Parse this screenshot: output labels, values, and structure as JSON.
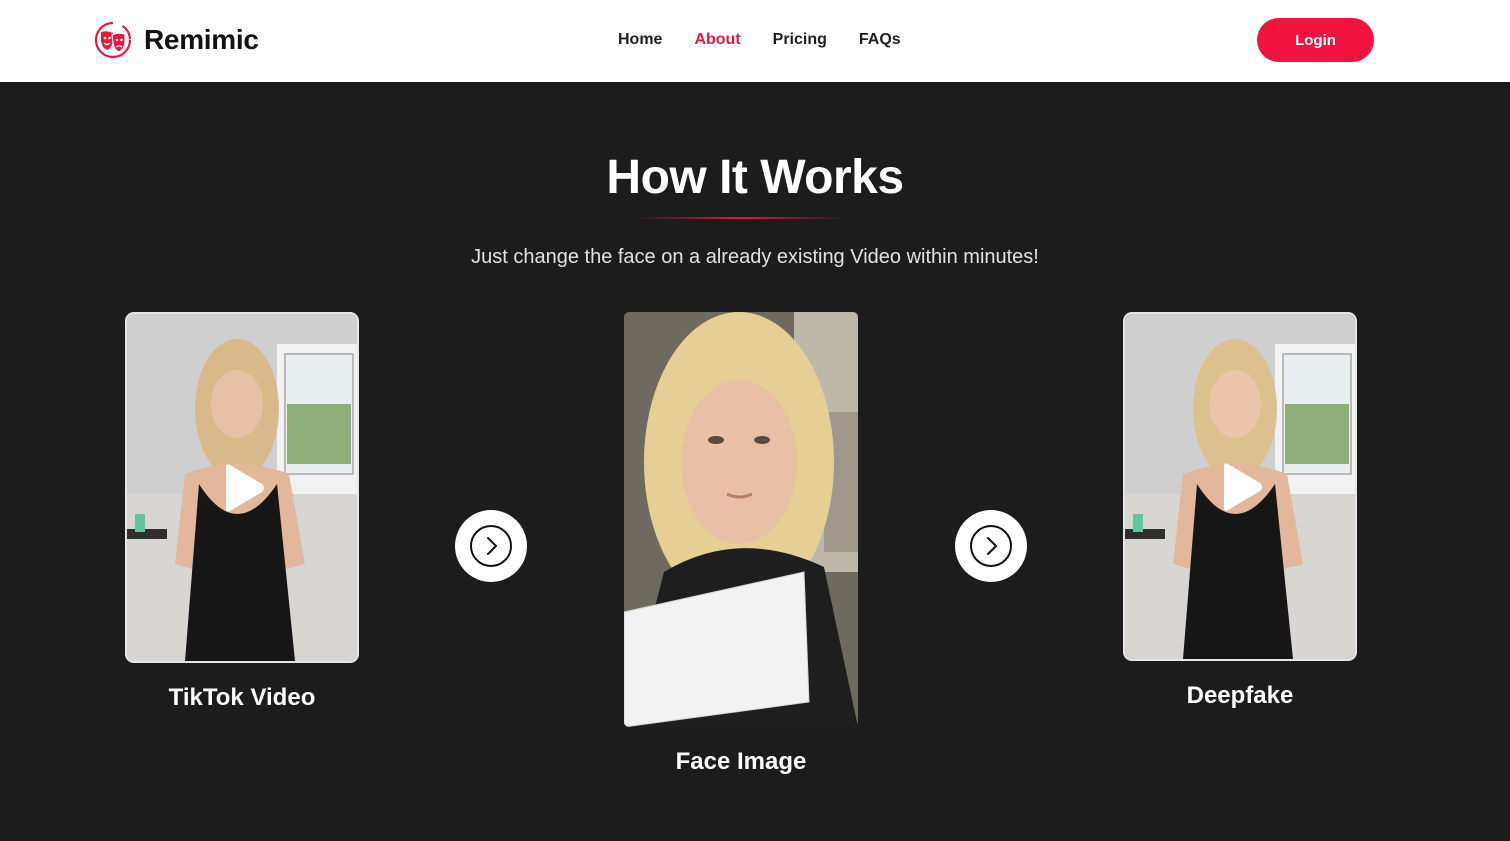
{
  "brand": {
    "name": "Remimic",
    "accent_color": "#e8173f"
  },
  "nav": {
    "items": [
      {
        "label": "Home",
        "active": false
      },
      {
        "label": "About",
        "active": true
      },
      {
        "label": "Pricing",
        "active": false
      },
      {
        "label": "FAQs",
        "active": false
      }
    ]
  },
  "header": {
    "login_label": "Login"
  },
  "how_it_works": {
    "title": "How It Works",
    "subtitle": "Just change the face on a already existing Video within minutes!",
    "steps": [
      {
        "label": "TikTok Video",
        "media": "video-thumbnail",
        "icon": "play-icon"
      },
      {
        "label": "Face Image",
        "media": "photo",
        "icon": ""
      },
      {
        "label": "Deepfake",
        "media": "video-thumbnail",
        "icon": "play-icon"
      }
    ],
    "connector_icon": "chevron-right-circle-icon"
  }
}
